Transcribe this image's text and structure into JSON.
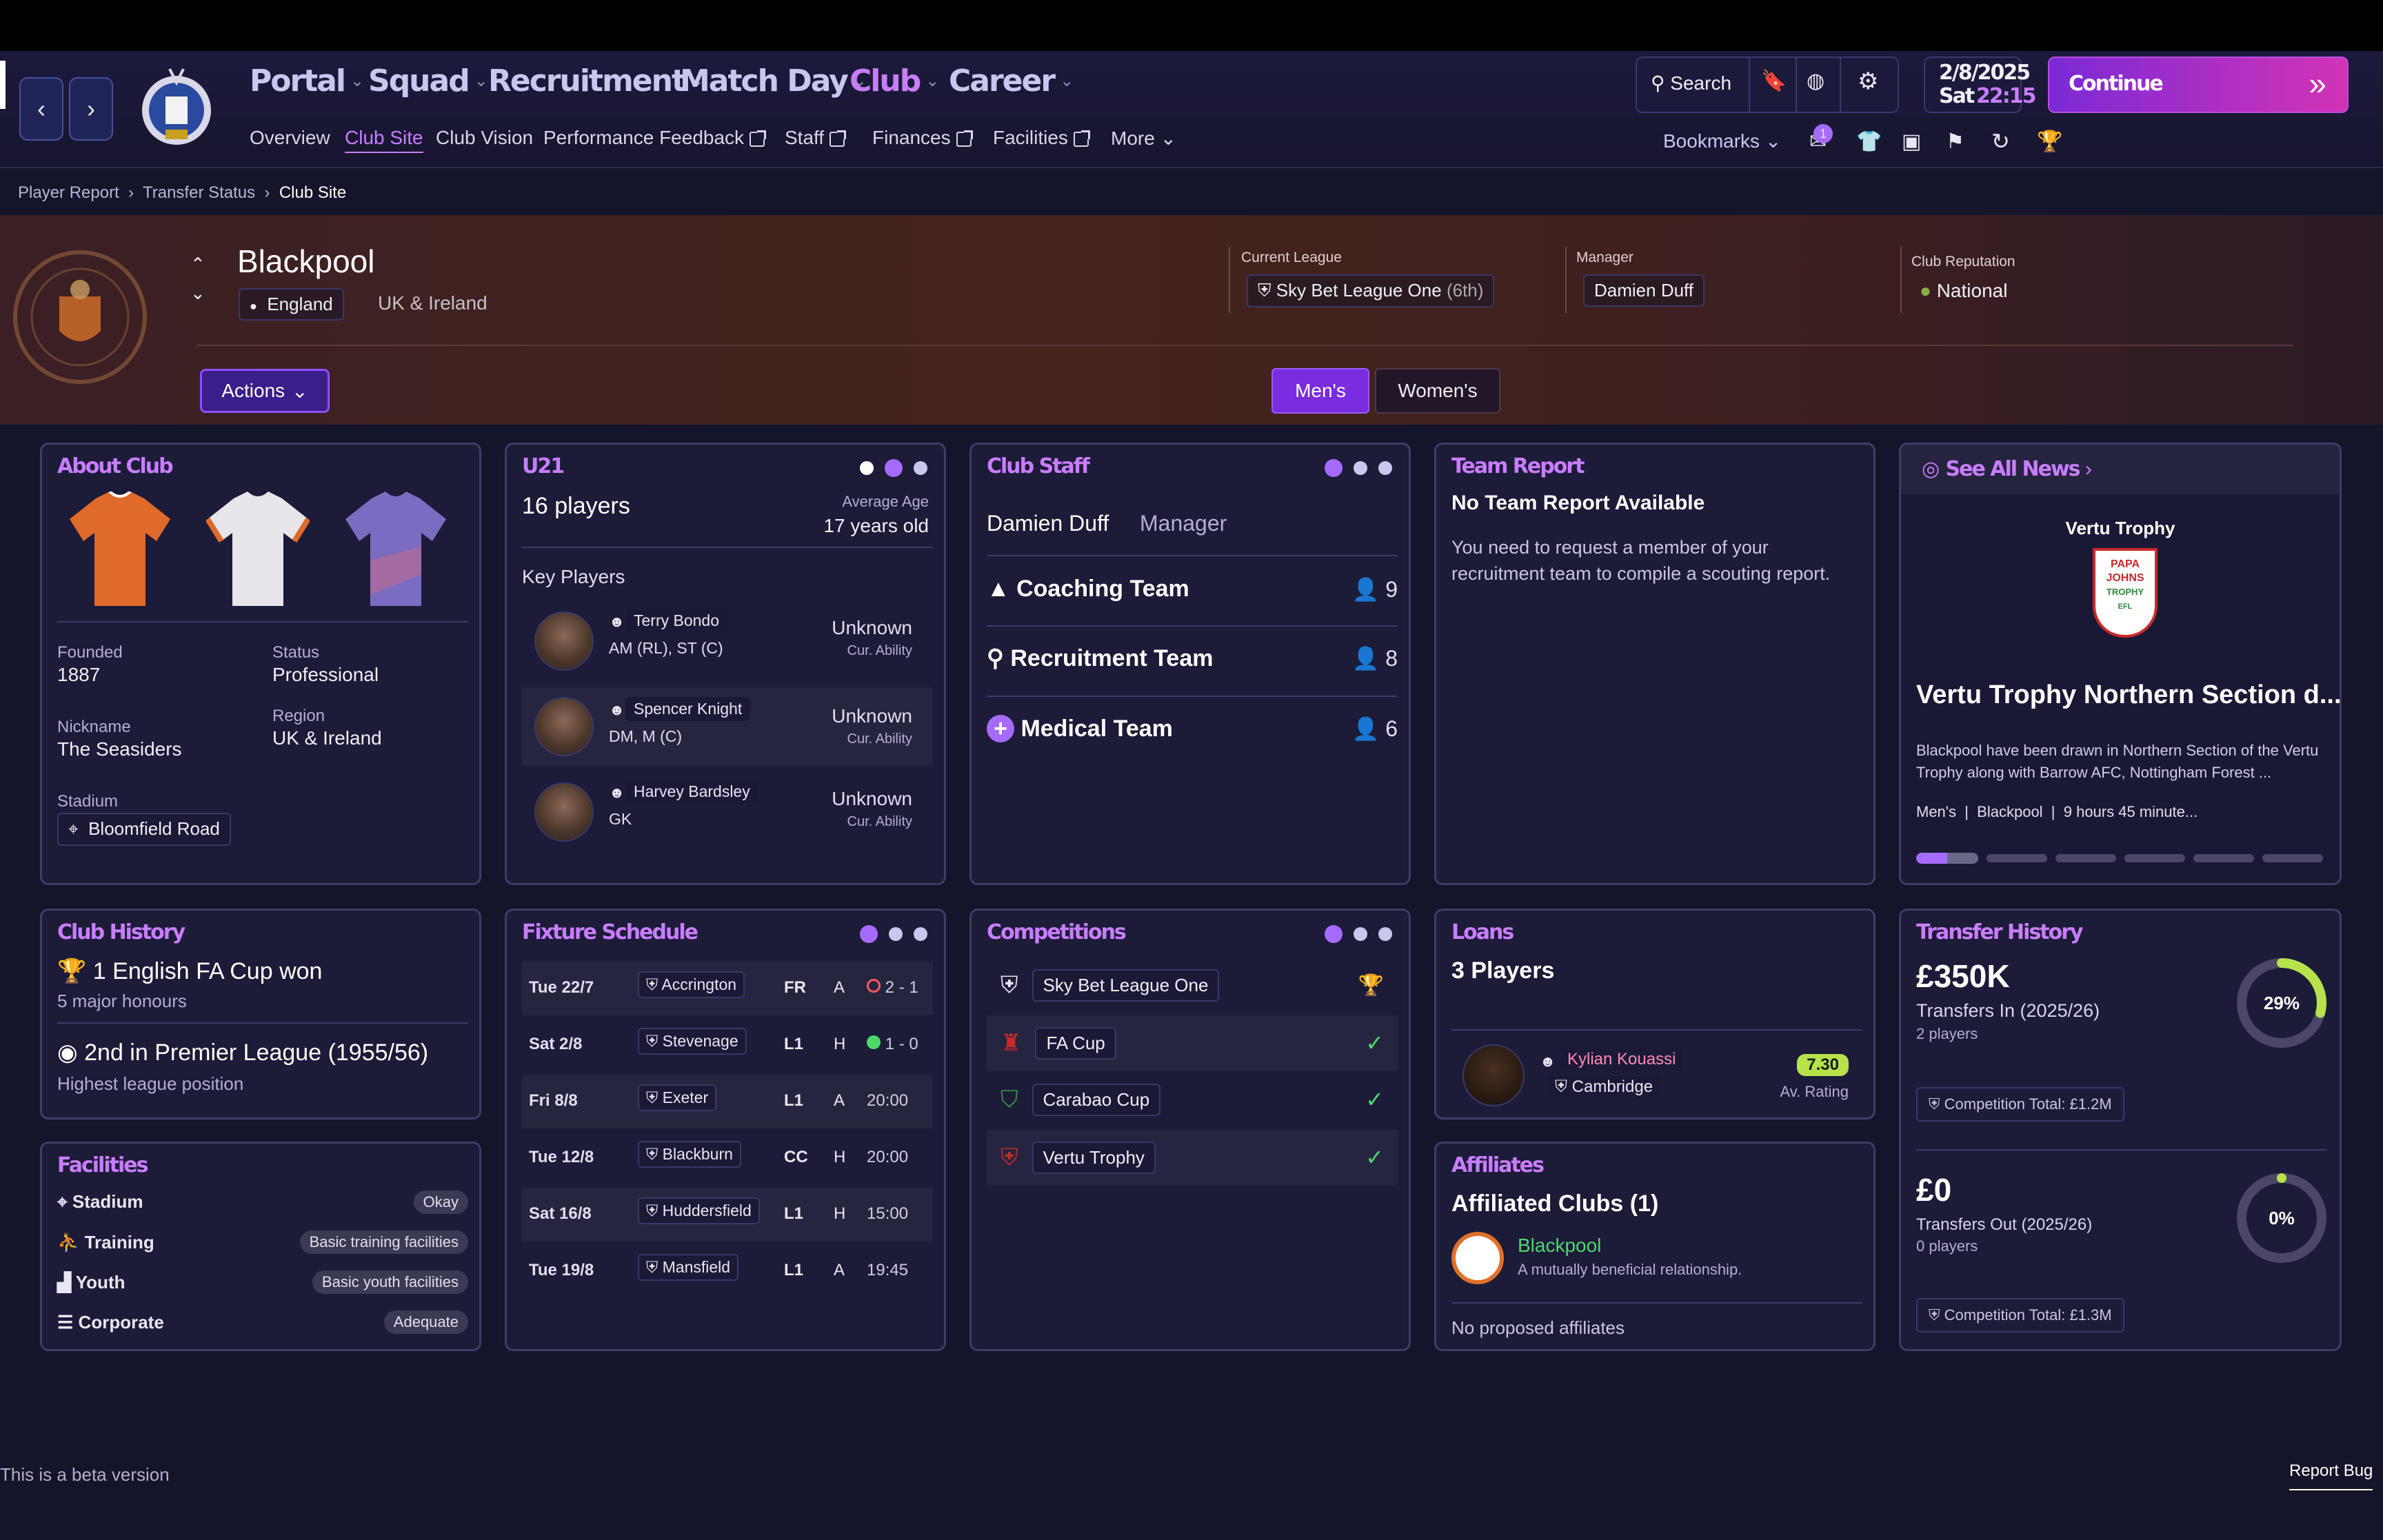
{
  "nav": {
    "main": [
      "Portal",
      "Squad",
      "Recruitment",
      "Match Day",
      "Club",
      "Career"
    ],
    "sub": [
      "Overview",
      "Club Site",
      "Club Vision",
      "Performance Feedback",
      "Staff",
      "Finances",
      "Facilities",
      "More"
    ],
    "search": "Search",
    "date": "2/8/2025",
    "day": "Sat",
    "time": "22:15",
    "continue": "Continue",
    "bookmarks": "Bookmarks",
    "badge": "1"
  },
  "breadcrumb": [
    "Player Report",
    "Transfer Status",
    "Club Site"
  ],
  "club": {
    "name": "Blackpool",
    "nation": "England",
    "region": "UK & Ireland",
    "league_label": "Current League",
    "league": "Sky Bet League One",
    "league_pos": "(6th)",
    "manager_label": "Manager",
    "manager": "Damien Duff",
    "rep_label": "Club Reputation",
    "rep": "National",
    "actions": "Actions",
    "mens": "Men's",
    "womens": "Women's"
  },
  "about": {
    "title": "About Club",
    "founded_l": "Founded",
    "founded": "1887",
    "status_l": "Status",
    "status": "Professional",
    "nick_l": "Nickname",
    "nick": "The Seasiders",
    "region_l": "Region",
    "region": "UK & Ireland",
    "stadium_l": "Stadium",
    "stadium": "Bloomfield Road"
  },
  "u21": {
    "title": "U21",
    "players": "16 players",
    "age_l": "Average Age",
    "age": "17 years old",
    "key": "Key Players",
    "list": [
      {
        "name": "Terry Bondo",
        "pos": "AM (RL), ST (C)",
        "ab": "Unknown",
        "abl": "Cur. Ability"
      },
      {
        "name": "Spencer Knight",
        "pos": "DM, M (C)",
        "ab": "Unknown",
        "abl": "Cur. Ability"
      },
      {
        "name": "Harvey Bardsley",
        "pos": "GK",
        "ab": "Unknown",
        "abl": "Cur. Ability"
      }
    ]
  },
  "staff": {
    "title": "Club Staff",
    "mgr": "Damien Duff",
    "mgr_role": "Manager",
    "teams": [
      {
        "name": "Coaching Team",
        "n": "9"
      },
      {
        "name": "Recruitment Team",
        "n": "8"
      },
      {
        "name": "Medical Team",
        "n": "6"
      }
    ]
  },
  "report": {
    "title": "Team Report",
    "head": "No Team Report Available",
    "body": "You need to request a member of your recruitment team to compile a scouting report."
  },
  "news": {
    "link": "See All News",
    "comp": "Vertu Trophy",
    "logo": [
      "PAPA",
      "JOHNS",
      "TROPHY",
      "EFL"
    ],
    "headline": "Vertu Trophy Northern Section d...",
    "body": "Blackpool have been drawn in Northern Section of the Vertu Trophy along with Barrow AFC, Nottingham Forest ...",
    "tags": [
      "Men's",
      "Blackpool",
      "9 hours 45 minute..."
    ]
  },
  "history": {
    "title": "Club History",
    "h1": "1 English FA Cup won",
    "h1s": "5 major honours",
    "h2": "2nd in Premier League (1955/56)",
    "h2s": "Highest league position"
  },
  "facilities": {
    "title": "Facilities",
    "items": [
      {
        "name": "Stadium",
        "v": "Okay"
      },
      {
        "name": "Training",
        "v": "Basic training facilities"
      },
      {
        "name": "Youth",
        "v": "Basic youth facilities"
      },
      {
        "name": "Corporate",
        "v": "Adequate"
      }
    ]
  },
  "fixtures": {
    "title": "Fixture Schedule",
    "rows": [
      {
        "d": "Tue 22/7",
        "t": "Accrington",
        "c": "FR",
        "ha": "A",
        "r": "2 - 1",
        "res": "loss"
      },
      {
        "d": "Sat 2/8",
        "t": "Stevenage",
        "c": "L1",
        "ha": "H",
        "r": "1 - 0",
        "res": "win"
      },
      {
        "d": "Fri 8/8",
        "t": "Exeter",
        "c": "L1",
        "ha": "A",
        "r": "20:00",
        "res": ""
      },
      {
        "d": "Tue 12/8",
        "t": "Blackburn",
        "c": "CC",
        "ha": "H",
        "r": "20:00",
        "res": ""
      },
      {
        "d": "Sat 16/8",
        "t": "Huddersfield",
        "c": "L1",
        "ha": "H",
        "r": "15:00",
        "res": ""
      },
      {
        "d": "Tue 19/8",
        "t": "Mansfield",
        "c": "L1",
        "ha": "A",
        "r": "19:45",
        "res": ""
      }
    ]
  },
  "comps": {
    "title": "Competitions",
    "items": [
      "Sky Bet League One",
      "FA Cup",
      "Carabao Cup",
      "Vertu Trophy"
    ]
  },
  "loans": {
    "title": "Loans",
    "count": "3 Players",
    "player": "Kylian Kouassi",
    "club": "Cambridge",
    "rating": "7.30",
    "rating_l": "Av. Rating"
  },
  "affiliates": {
    "title": "Affiliates",
    "head": "Affiliated Clubs (1)",
    "club": "Blackpool",
    "desc": "A mutually beneficial relationship.",
    "none": "No proposed affiliates"
  },
  "transfers": {
    "title": "Transfer History",
    "in_amt": "£350K",
    "in_l": "Transfers In (2025/26)",
    "in_p": "2 players",
    "in_pct": "29%",
    "in_frac": 0.29,
    "in_total": "Competition Total: £1.2M",
    "out_amt": "£0",
    "out_l": "Transfers Out (2025/26)",
    "out_p": "0 players",
    "out_pct": "0%",
    "out_frac": 0,
    "out_total": "Competition Total: £1.3M"
  },
  "footer": {
    "beta": "This is a beta version",
    "bug": "Report Bug"
  },
  "colors": {
    "accent": "#a56bff",
    "title": "#c87dff",
    "win": "#4cd96a",
    "loss": "#ff5a5a",
    "continue": "#c433c9"
  }
}
